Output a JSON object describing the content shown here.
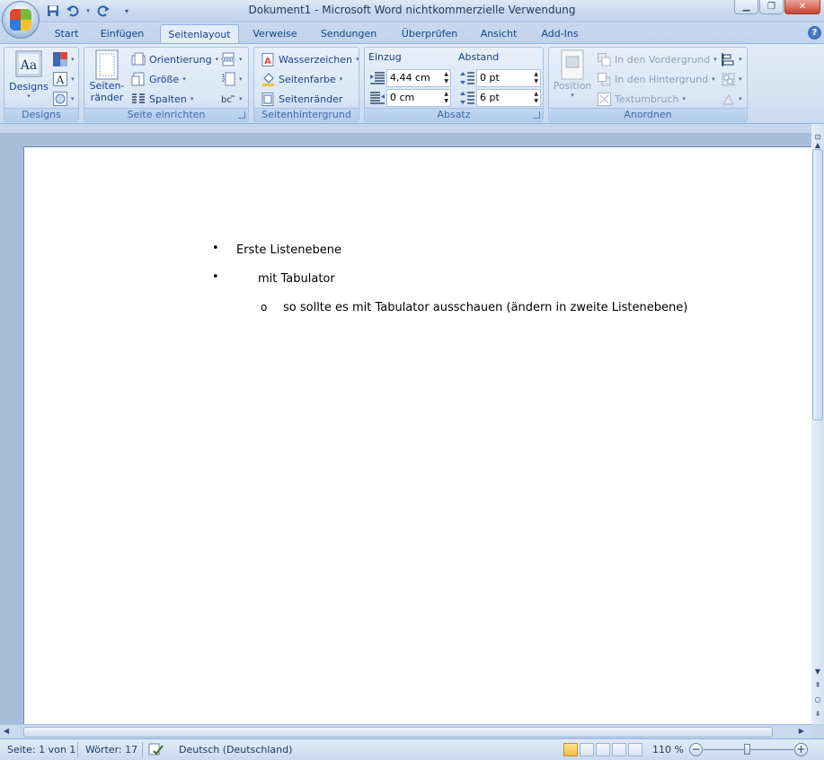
{
  "window": {
    "title": "Dokument1 - Microsoft Word nichtkommerzielle Verwendung",
    "min_label": "▁",
    "max_label": "❐",
    "close_label": "✕"
  },
  "qat": {
    "save_icon": "save-icon",
    "undo_icon": "undo-icon",
    "redo_icon": "redo-icon",
    "customize_icon": "customize-icon"
  },
  "tabs": [
    {
      "label": "Start",
      "active": false
    },
    {
      "label": "Einfügen",
      "active": false
    },
    {
      "label": "Seitenlayout",
      "active": true
    },
    {
      "label": "Verweise",
      "active": false
    },
    {
      "label": "Sendungen",
      "active": false
    },
    {
      "label": "Überprüfen",
      "active": false
    },
    {
      "label": "Ansicht",
      "active": false
    },
    {
      "label": "Add-Ins",
      "active": false
    }
  ],
  "help_label": "?",
  "ribbon": {
    "designs": {
      "label": "Designs",
      "button": "Designs"
    },
    "seite": {
      "label": "Seite einrichten",
      "margins_line1": "Seiten-",
      "margins_line2": "ränder",
      "orientation": "Orientierung",
      "size": "Größe",
      "columns": "Spalten"
    },
    "hintergrund": {
      "label": "Seitenhintergrund",
      "watermark": "Wasserzeichen",
      "pagecolor": "Seitenfarbe",
      "borders": "Seitenränder"
    },
    "absatz": {
      "label": "Absatz",
      "indent_heading": "Einzug",
      "spacing_heading": "Abstand",
      "indent_left": "4,44 cm",
      "indent_right": "0 cm",
      "spacing_before": "0 pt",
      "spacing_after": "6 pt"
    },
    "anordnen": {
      "label": "Anordnen",
      "position": "Position",
      "front": "In den Vordergrund",
      "back": "In den Hintergrund",
      "wrap": "Textumbruch"
    }
  },
  "document": {
    "items": [
      {
        "bullet": "•",
        "text": "Erste Listenebene"
      },
      {
        "bullet": "•",
        "text": "mit Tabulator"
      },
      {
        "bullet": "o",
        "text": "so sollte es mit Tabulator ausschauen (ändern in zweite Listenebene)"
      }
    ]
  },
  "status": {
    "page": "Seite: 1 von 1",
    "words": "Wörter: 17",
    "language": "Deutsch (Deutschland)",
    "zoom": "110 %",
    "zoom_minus": "−",
    "zoom_plus": "+"
  },
  "colors": {
    "ribbon_text": "#15428b",
    "accent": "#8db2e3"
  }
}
